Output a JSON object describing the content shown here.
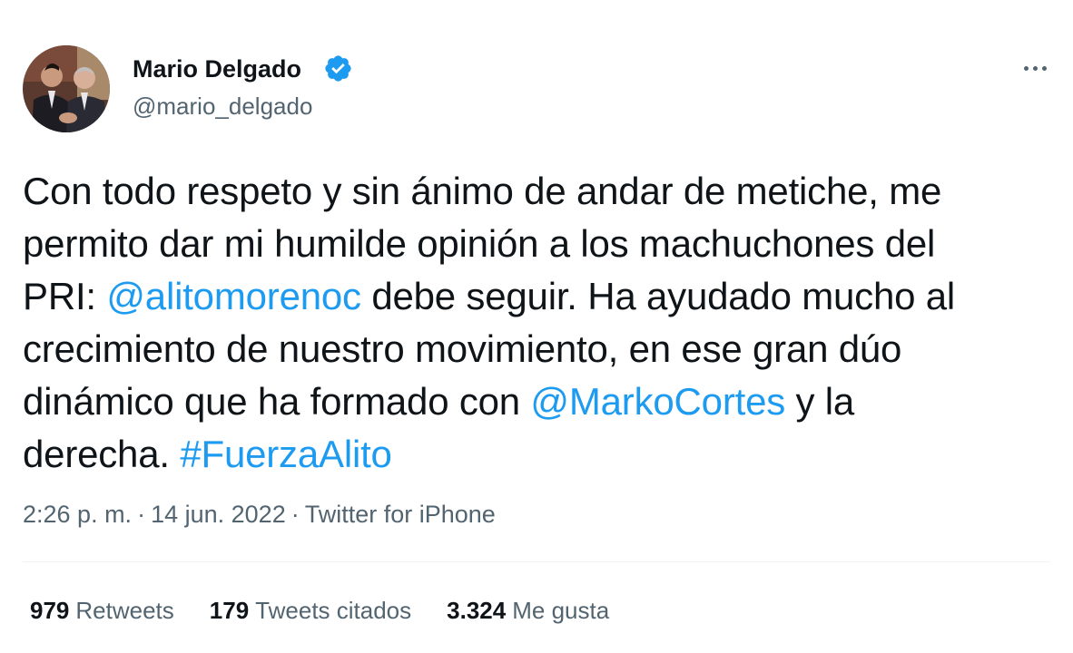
{
  "author": {
    "name": "Mario Delgado",
    "handle": "@mario_delgado",
    "verified": true
  },
  "tweet": {
    "lines": [
      [
        {
          "text": "Con todo respeto y sin ánimo de andar de metiche, me"
        }
      ],
      [
        {
          "text": "permito dar mi humilde opinión a los machuchones del"
        }
      ],
      [
        {
          "text": "PRI: "
        },
        {
          "text": "@alitomorenoc",
          "link": true
        },
        {
          "text": " debe seguir. Ha ayudado mucho al"
        }
      ],
      [
        {
          "text": "crecimiento de nuestro movimiento, en ese gran dúo"
        }
      ],
      [
        {
          "text": "dinámico que ha formado con "
        },
        {
          "text": "@MarkoCortes",
          "link": true
        },
        {
          "text": " y la"
        }
      ],
      [
        {
          "text": "derecha.  "
        },
        {
          "text": "#FuerzaAlito",
          "link": true
        }
      ]
    ]
  },
  "meta": {
    "time": "2:26 p. m.",
    "separator": "·",
    "date": "14 jun. 2022",
    "source": "Twitter for iPhone"
  },
  "stats": {
    "retweets": {
      "count": "979",
      "label": "Retweets"
    },
    "quotes": {
      "count": "179",
      "label": "Tweets citados"
    },
    "likes": {
      "count": "3.324",
      "label": "Me gusta"
    }
  },
  "colors": {
    "link": "#1d9bf0",
    "text": "#0f1419",
    "secondary": "#536471",
    "verified": "#1d9bf0"
  },
  "icons": {
    "verified": "verified-badge-icon",
    "more": "more-options-icon"
  }
}
